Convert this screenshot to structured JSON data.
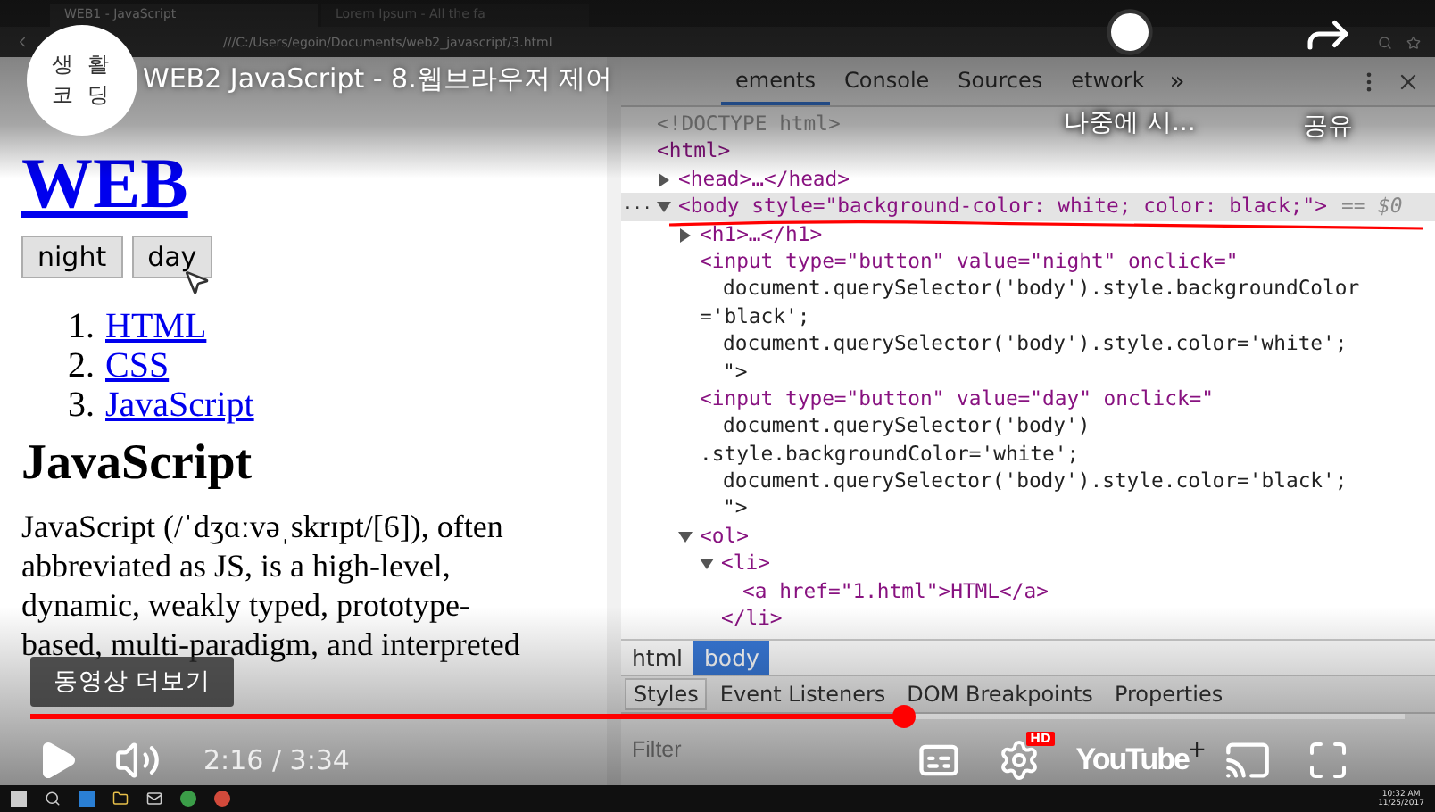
{
  "browser": {
    "tabs": [
      {
        "label": "WEB1 - JavaScript",
        "selected": true
      },
      {
        "label": "Lorem Ipsum - All the fa",
        "selected": false
      }
    ],
    "address": "///C:/Users/egoin/Documents/web2_javascript/3.html"
  },
  "page": {
    "heading": "WEB",
    "buttons": [
      "night",
      "day"
    ],
    "list": [
      {
        "number": "1.",
        "label": "HTML"
      },
      {
        "number": "2.",
        "label": "CSS"
      },
      {
        "number": "3.",
        "label": "JavaScript"
      }
    ],
    "subheading": "JavaScript",
    "paragraph": [
      "JavaScript (/ˈdʒɑːvəˌskrɪpt/[6]), often",
      "abbreviated as JS, is a high-level,",
      "dynamic, weakly typed, prototype-",
      "based, multi-paradigm, and interpreted"
    ]
  },
  "devtools": {
    "tabs": [
      {
        "label": "ements",
        "selected": true
      },
      {
        "label": "Console",
        "selected": false
      },
      {
        "label": "Sources",
        "selected": false
      },
      {
        "label": "etwork",
        "selected": false
      }
    ],
    "more": "»",
    "tree": [
      {
        "lines": [
          {
            "text": "<!DOCTYPE html>"
          }
        ],
        "kind": "doctype"
      },
      {
        "lines": [
          {
            "text": "<html>"
          }
        ],
        "children": [
          {
            "lines": [
              {
                "text": "<head>…</head>"
              }
            ],
            "expanded": false
          },
          {
            "lines": [
              {
                "text": "<body style=\"background-color: white; color: black;\">"
              }
            ],
            "expanded": true,
            "selected": true,
            "gutter": "...",
            "suffix": "== $0",
            "children": [
              {
                "lines": [
                  {
                    "text": "<h1>…</h1>"
                  }
                ],
                "expanded": false
              },
              {
                "lines": [
                  {
                    "text": "<input type=\"button\" value=\"night\" onclick=\""
                  },
                  {
                    "text": "document.querySelector('body').style.backgroundColor",
                    "kind": "cont"
                  },
                  {
                    "text": "='black';",
                    "kind": "wrap"
                  },
                  {
                    "text": "document.querySelector('body').style.color='white';",
                    "kind": "cont"
                  },
                  {
                    "text": "\">",
                    "kind": "cont"
                  }
                ]
              },
              {
                "lines": [
                  {
                    "text": "<input type=\"button\" value=\"day\" onclick=\""
                  },
                  {
                    "text": "document.querySelector('body')",
                    "kind": "cont"
                  },
                  {
                    "text": ".style.backgroundColor='white';",
                    "kind": "wrap"
                  },
                  {
                    "text": "document.querySelector('body').style.color='black';",
                    "kind": "cont"
                  },
                  {
                    "text": "\">",
                    "kind": "cont"
                  }
                ]
              },
              {
                "lines": [
                  {
                    "text": "<ol>"
                  }
                ],
                "expanded": true,
                "children": [
                  {
                    "lines": [
                      {
                        "text": "<li>"
                      }
                    ],
                    "expanded": true,
                    "close": "</li>",
                    "children": [
                      {
                        "lines": [
                          {
                            "text": "<a href=\"1.html\">HTML</a>"
                          }
                        ]
                      }
                    ]
                  }
                ]
              }
            ]
          }
        ]
      }
    ],
    "breadcrumbs": [
      {
        "label": "html",
        "selected": false
      },
      {
        "label": "body",
        "selected": true
      }
    ],
    "panel_tabs": [
      {
        "label": "Styles",
        "selected": true
      },
      {
        "label": "Event Listeners",
        "selected": false
      },
      {
        "label": "DOM Breakpoints",
        "selected": false
      },
      {
        "label": "Properties",
        "selected": false
      }
    ],
    "filter": {
      "placeholder": "Filter"
    },
    "filter_tools": [
      "+"
    ]
  },
  "taskbar": {
    "time": "10:32 AM",
    "date": "11/25/2017"
  },
  "player": {
    "channel": [
      "생 활",
      "코 딩"
    ],
    "title": "WEB2 JavaScript - 8.웹브라우저 제어",
    "watch_later": "나중에 시...",
    "share": "공유",
    "more_videos": "동영상 더보기",
    "progress": {
      "level": 0.635
    },
    "time": "2:16 / 3:34",
    "hd": "HD",
    "logo": "YouTube"
  }
}
